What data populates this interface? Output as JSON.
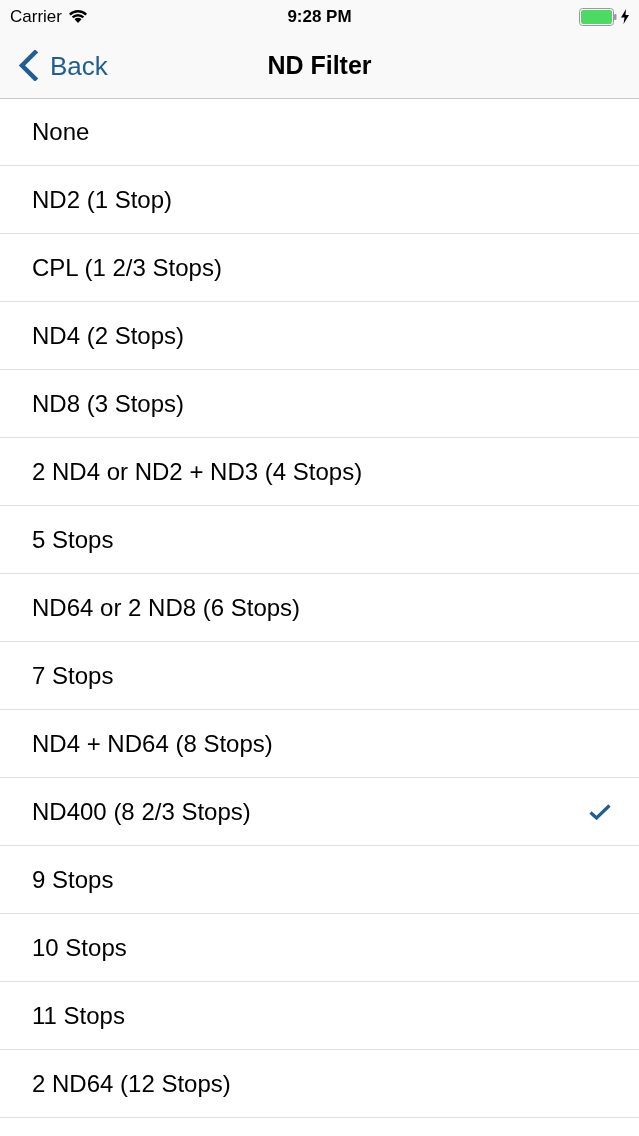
{
  "status_bar": {
    "carrier": "Carrier",
    "time": "9:28 PM"
  },
  "nav_bar": {
    "back_label": "Back",
    "title": "ND Filter"
  },
  "options": [
    {
      "label": "None",
      "selected": false
    },
    {
      "label": "ND2 (1 Stop)",
      "selected": false
    },
    {
      "label": "CPL (1 2/3 Stops)",
      "selected": false
    },
    {
      "label": "ND4 (2 Stops)",
      "selected": false
    },
    {
      "label": "ND8 (3 Stops)",
      "selected": false
    },
    {
      "label": "2 ND4 or ND2 + ND3 (4 Stops)",
      "selected": false
    },
    {
      "label": "5 Stops",
      "selected": false
    },
    {
      "label": "ND64 or 2 ND8 (6 Stops)",
      "selected": false
    },
    {
      "label": "7 Stops",
      "selected": false
    },
    {
      "label": "ND4 + ND64 (8 Stops)",
      "selected": false
    },
    {
      "label": "ND400 (8 2/3 Stops)",
      "selected": true
    },
    {
      "label": "9 Stops",
      "selected": false
    },
    {
      "label": "10 Stops",
      "selected": false
    },
    {
      "label": "11 Stops",
      "selected": false
    },
    {
      "label": "2 ND64 (12 Stops)",
      "selected": false
    }
  ]
}
